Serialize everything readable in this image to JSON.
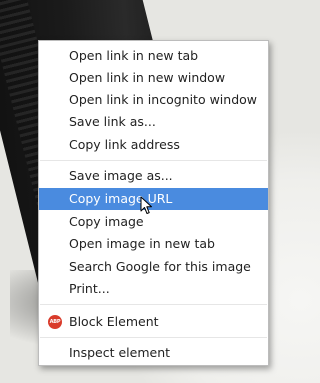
{
  "context_menu": {
    "items": [
      {
        "label": "Open link in new tab"
      },
      {
        "label": "Open link in new window"
      },
      {
        "label": "Open link in incognito window"
      },
      {
        "label": "Save link as..."
      },
      {
        "label": "Copy link address"
      },
      {
        "label": "Save image as..."
      },
      {
        "label": "Copy image URL"
      },
      {
        "label": "Copy image"
      },
      {
        "label": "Open image in new tab"
      },
      {
        "label": "Search Google for this image"
      },
      {
        "label": "Print..."
      },
      {
        "label": "Block Element"
      },
      {
        "label": "Inspect element"
      }
    ],
    "highlighted_item": "Copy image URL",
    "abp_icon_text": "ABP"
  },
  "colors": {
    "highlight": "#4a8bdf",
    "abp_icon": "#d93b2b"
  }
}
